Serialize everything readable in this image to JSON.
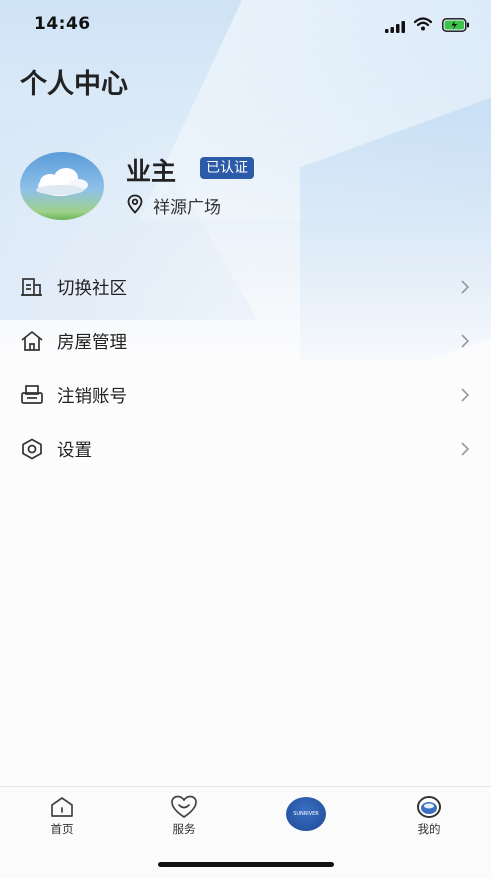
{
  "status": {
    "time": "14:46"
  },
  "page": {
    "title": "个人中心"
  },
  "profile": {
    "name": "业主",
    "badge": "已认证",
    "location": "祥源广场"
  },
  "menu": {
    "items": [
      {
        "label": "切换社区",
        "icon": "building-switch-icon"
      },
      {
        "label": "房屋管理",
        "icon": "house-icon"
      },
      {
        "label": "注销账号",
        "icon": "printer-icon"
      },
      {
        "label": "设置",
        "icon": "hexagon-settings-icon"
      }
    ]
  },
  "tabbar": {
    "tabs": [
      {
        "label": "首页",
        "icon": "home-icon"
      },
      {
        "label": "服务",
        "icon": "smile-heart-icon"
      },
      {
        "label": "",
        "icon": "brand-logo-icon",
        "logo_text": "SUNRIVER"
      },
      {
        "label": "我的",
        "icon": "profile-avatar-icon"
      }
    ]
  },
  "colors": {
    "accent": "#2b5aa8",
    "text": "#222222"
  }
}
